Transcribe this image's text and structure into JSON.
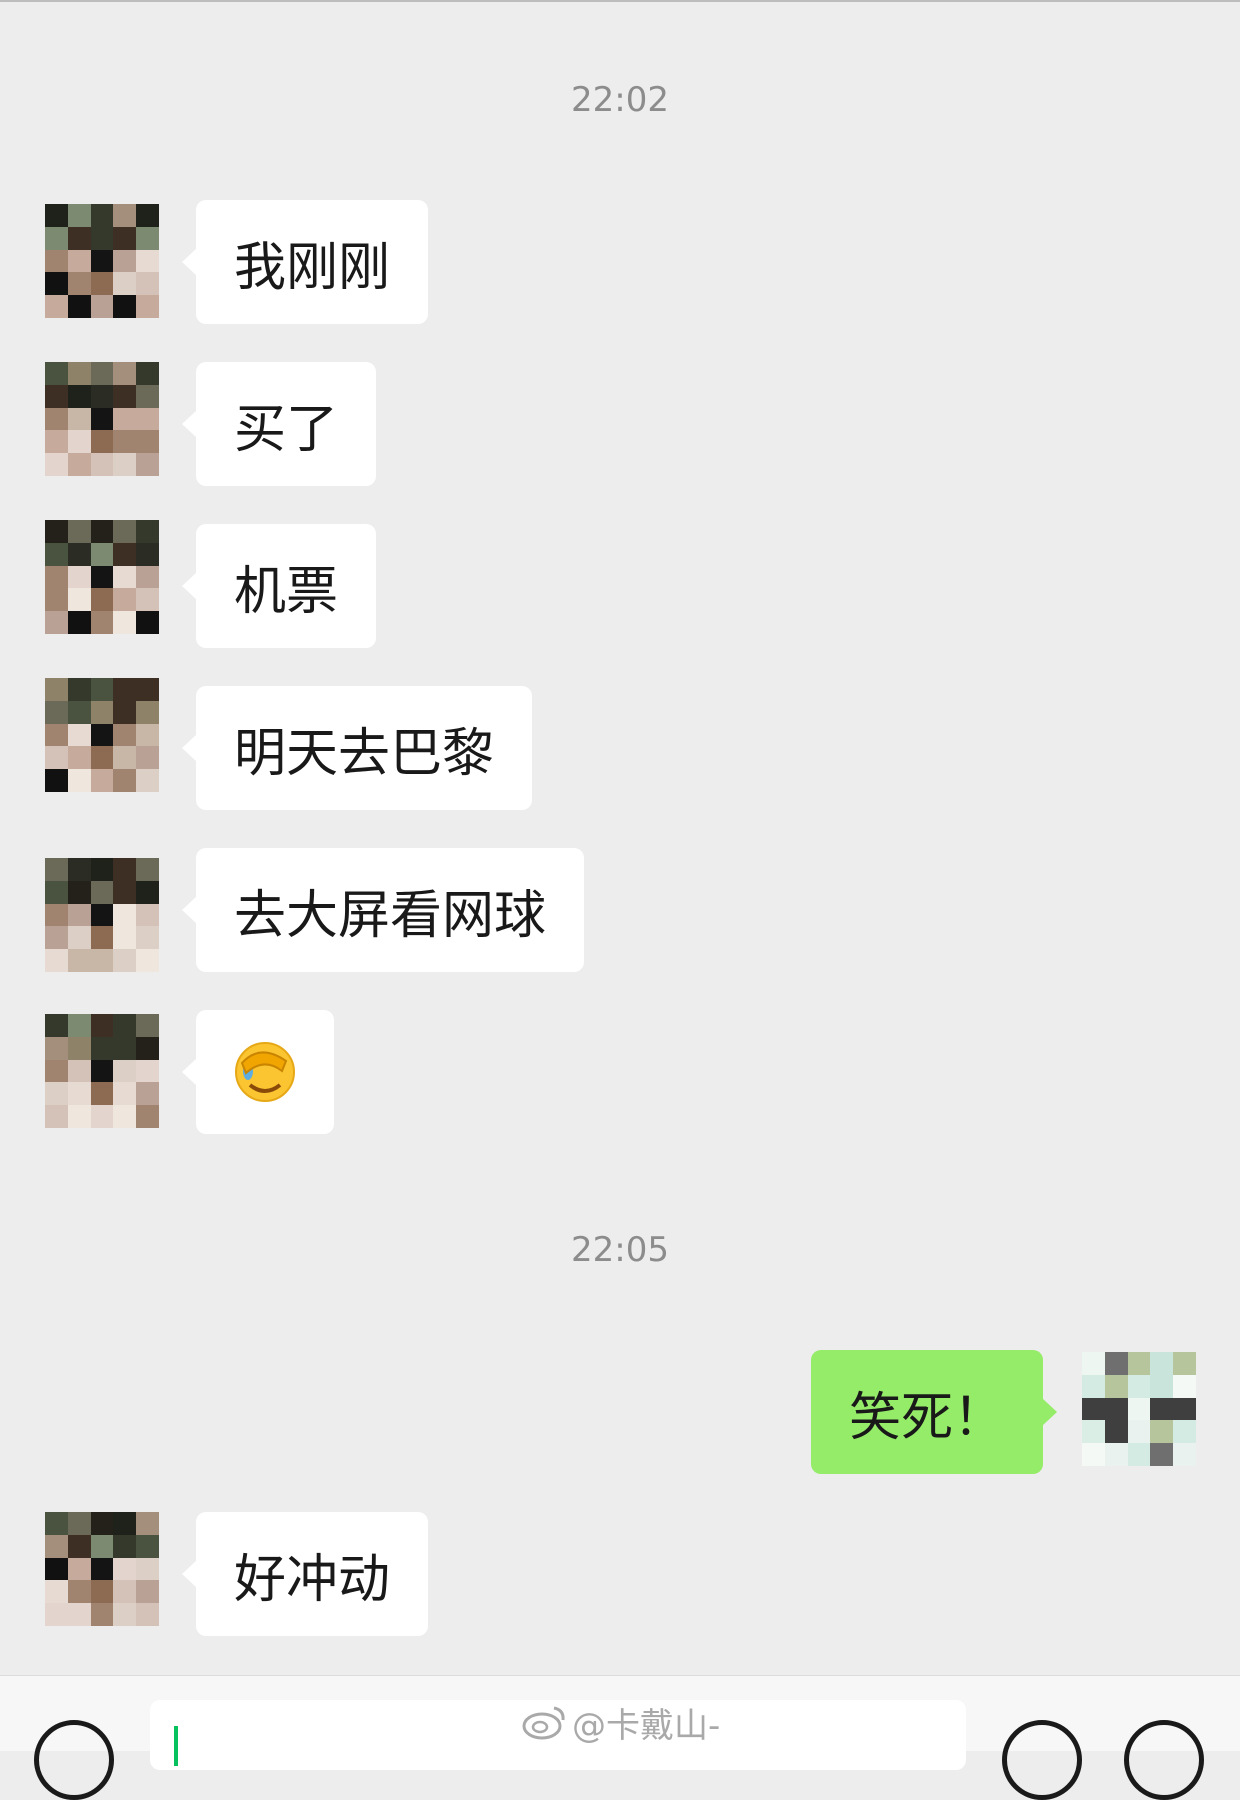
{
  "chat": {
    "timestamps": [
      "22:02",
      "22:05"
    ],
    "messages": [
      {
        "sender": "other",
        "text": "我刚刚"
      },
      {
        "sender": "other",
        "text": "买了"
      },
      {
        "sender": "other",
        "text": "机票"
      },
      {
        "sender": "other",
        "text": "明天去巴黎"
      },
      {
        "sender": "other",
        "text": "去大屏看网球"
      },
      {
        "sender": "other",
        "text": "",
        "emoji": "facepalm-emoji"
      },
      {
        "sender": "self",
        "text": "笑死！"
      },
      {
        "sender": "other",
        "text": "好冲动"
      }
    ]
  },
  "input_bar": {
    "value": "",
    "icons": [
      "voice-icon",
      "emoji-icon",
      "plus-icon"
    ]
  },
  "watermark": {
    "text": "@卡戴山-",
    "icon": "weibo-icon"
  },
  "colors": {
    "background": "#ededed",
    "incoming_bubble": "#ffffff",
    "outgoing_bubble": "#95ec69",
    "timestamp": "#8c8c8c",
    "caret": "#07c160"
  }
}
